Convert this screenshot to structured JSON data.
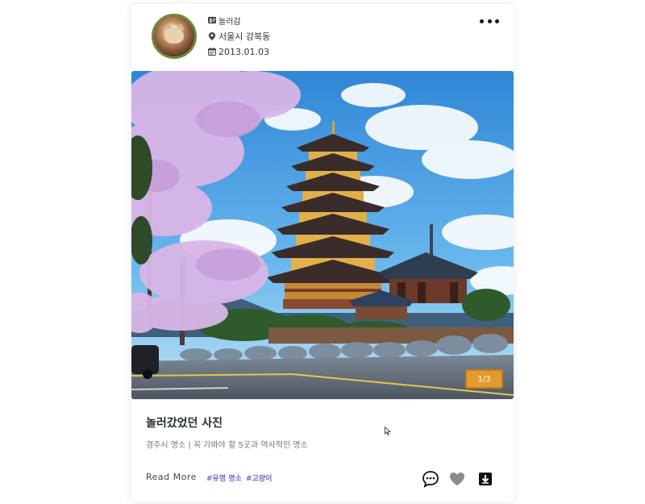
{
  "post": {
    "user": "놀러감",
    "location": "서울시 강북동",
    "date": "2013.01.03",
    "image_counter": "1/3",
    "title": "놀러갔었던 사진",
    "description": "경주시 명소 | 꼭 가봐야 할 5곳과 역사적인 명소",
    "read_more": "Read More",
    "tags": [
      "#유명 명소",
      "#고양이"
    ]
  },
  "icons": {
    "user": "id-card-icon",
    "location": "map-pin-icon",
    "date": "calendar-icon",
    "more": "more-dots-icon",
    "comment": "comment-icon",
    "like": "heart-icon",
    "download": "download-icon"
  },
  "colors": {
    "avatar_border": "#6f8a3e",
    "counter_badge": "#e39b30",
    "tag_text": "#6a68c8",
    "title_text": "#1f2e25",
    "heart": "#8c8c8c"
  }
}
